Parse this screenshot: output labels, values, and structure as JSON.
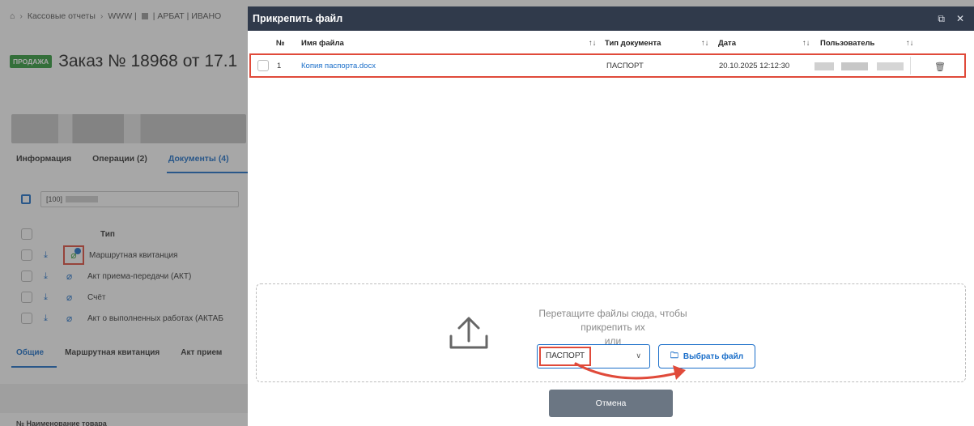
{
  "background": {
    "breadcrumb": [
      "Кассовые отчеты",
      "WWW |",
      "| АРБАТ | ИВАНО"
    ],
    "order_badge": "ПРОДАЖА",
    "order_title": "Заказ № 18968 от 17.1",
    "tabs": [
      "Информация",
      "Операции (2)",
      "Документы (4)"
    ],
    "code_prefix": "[100]",
    "doc_type_header": "Тип",
    "documents": [
      "Маршрутная квитанция",
      "Акт приема-передачи (АКТ)",
      "Счёт",
      "Акт о выполненных работах (АКТАБ"
    ],
    "subtabs": [
      "Общие",
      "Маршрутная квитанция",
      "Акт прием"
    ],
    "bottom_text": "№  Наименование товара"
  },
  "modal": {
    "title": "Прикрепить файл",
    "columns": {
      "num": "№",
      "filename": "Имя файла",
      "doc_type": "Тип документа",
      "date": "Дата",
      "user": "Пользователь"
    },
    "files": [
      {
        "num": "1",
        "filename": "Копия паспорта.docx",
        "doc_type": "ПАСПОРТ",
        "date": "20.10.2025 12:12:30"
      }
    ],
    "drop_text_1": "Перетащите файлы сюда, чтобы прикрепить их",
    "drop_text_2": "или",
    "doc_type_value": "ПАСПОРТ",
    "pick_file_label": "Выбрать файл",
    "cancel_label": "Отмена"
  },
  "colors": {
    "accent": "#1a6ec9",
    "highlight": "#e04a3a",
    "header": "#303a4b",
    "badge": "#2e9a3a"
  }
}
